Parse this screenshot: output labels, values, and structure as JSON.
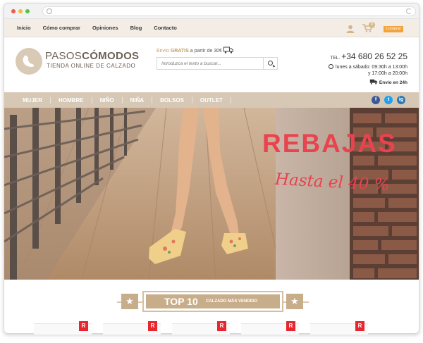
{
  "topnav": {
    "links": [
      "Inicio",
      "Cómo comprar",
      "Opiniones",
      "Blog",
      "Contacto"
    ],
    "cart_count": "0",
    "comprar_label": "Comprar"
  },
  "header": {
    "brand_light": "PASOS",
    "brand_bold": "CÓMODOS",
    "brand_sub": "TIENDA ONLINE DE CALZADO",
    "envio_prefix": "Envío",
    "envio_bold": "GRATIS",
    "envio_suffix": "a partir de 30€",
    "search_placeholder": "Introduzca el texto a buscar...",
    "tel_prefix": "TEL.",
    "tel_number": "+34 680 26 52 25",
    "hours_line1": "lunes a sábado: 09:30h a 13:00h",
    "hours_line2": "y 17:00h a 20:00h",
    "shipping_24": "Envío en 24h"
  },
  "catnav": {
    "items": [
      "MUJER",
      "HOMBRE",
      "NIÑO",
      "NIÑA",
      "BOLSOS",
      "OUTLET"
    ],
    "social": [
      "f",
      "t",
      "ig"
    ]
  },
  "hero": {
    "headline": "REBAJAS",
    "subline": "Hasta el 40 %"
  },
  "top10": {
    "title": "TOP 10",
    "subtitle": "CALZADO MÁS VENDIDO",
    "star": "★"
  },
  "cards": {
    "tag": "R"
  },
  "colors": {
    "accent_beige": "#d7c8b5",
    "sale_red": "#e8434f",
    "comprar_orange": "#f2a33a"
  }
}
